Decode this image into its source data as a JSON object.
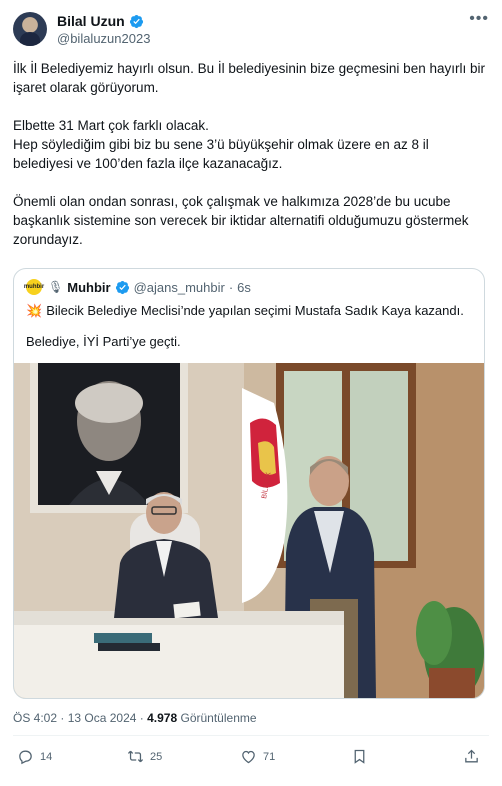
{
  "author": {
    "name": "Bilal Uzun",
    "handle": "@bilaluzun2023",
    "more_icon": "more-icon"
  },
  "tweet": {
    "text": "İlk İl Belediyemiz hayırlı olsun. Bu İl belediyesinin bize geçmesini ben hayırlı bir işaret olarak görüyorum.\n\nElbette 31 Mart çok farklı olacak.\nHep söylediğim gibi biz bu sene 3’ü büyükşehir olmak üzere en az 8 il belediyesi ve 100’den fazla ilçe kazanacağız.\n\nÖnemli olan ondan sonrası, çok çalışmak ve halkımıza 2028’de bu ucube başkanlık sistemine son verecek bir iktidar alternatifi olduğumuzu göstermek zorundayız."
  },
  "quote": {
    "logo_text": "muhbir",
    "name": "Muhbir",
    "handle": "@ajans_muhbir",
    "separator": "·",
    "time": "6s",
    "text1": "Bilecik Belediye Meclisi’nde yapılan seçimi Mustafa Sadık Kaya kazandı.",
    "text2": "Belediye, İYİ Parti’ye geçti.",
    "flag_text": "BİLECİK"
  },
  "meta": {
    "time": "ÖS 4:02",
    "separator": "·",
    "date": "13 Oca 2024",
    "views": "4.978",
    "views_label": "Görüntülenme"
  },
  "actions": {
    "replies": "14",
    "reposts": "25",
    "likes": "71"
  },
  "colors": {
    "verified": "#1d9bf0",
    "text": "#0f1419",
    "secondary": "#536471",
    "border": "#cfd9de"
  }
}
